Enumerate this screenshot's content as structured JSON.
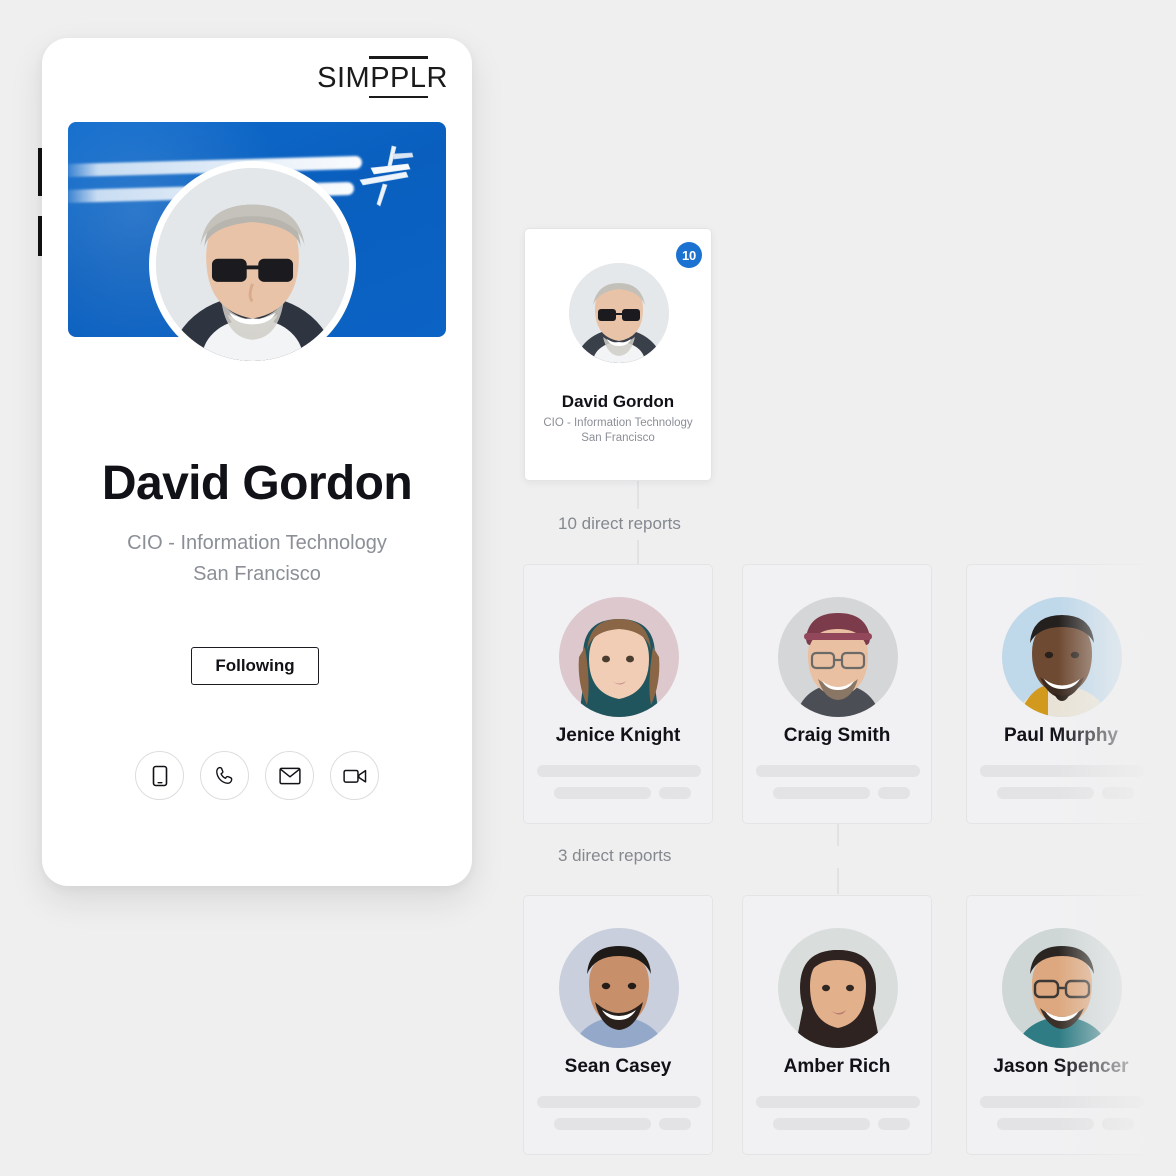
{
  "theme": {
    "page_bg": "#efefef",
    "banner_blue": "#0b63c5",
    "badge_blue": "#1b72d1",
    "card_bg": "#f1f1f3",
    "skeleton": "#e3e3e5",
    "muted_text": "#8b8f96"
  },
  "brand": {
    "logo_prefix": "SIM",
    "logo_mark": "PPL",
    "logo_suffix": "R",
    "logo_full": "SIMPPLR"
  },
  "profile": {
    "name": "David Gordon",
    "title": "CIO - Information Technology",
    "location": "San Francisco",
    "follow_label": "Following",
    "banner_alt": "airplane-contrail-sky",
    "actions": [
      {
        "name": "mobile-icon",
        "label": "Mobile"
      },
      {
        "name": "phone-icon",
        "label": "Phone"
      },
      {
        "name": "email-icon",
        "label": "Email"
      },
      {
        "name": "video-icon",
        "label": "Video call"
      }
    ]
  },
  "org_chart": {
    "root": {
      "name": "David Gordon",
      "title": "CIO - Information Technology",
      "location": "San Francisco",
      "badge_count": "10"
    },
    "labels": {
      "level_one": "10 direct reports",
      "level_two": "3 direct reports"
    },
    "level_one": [
      {
        "name": "Jenice Knight"
      },
      {
        "name": "Craig Smith"
      },
      {
        "name": "Paul Murphy"
      }
    ],
    "level_two": [
      {
        "name": "Sean Casey"
      },
      {
        "name": "Amber Rich"
      },
      {
        "name": "Jason Spencer"
      }
    ]
  }
}
